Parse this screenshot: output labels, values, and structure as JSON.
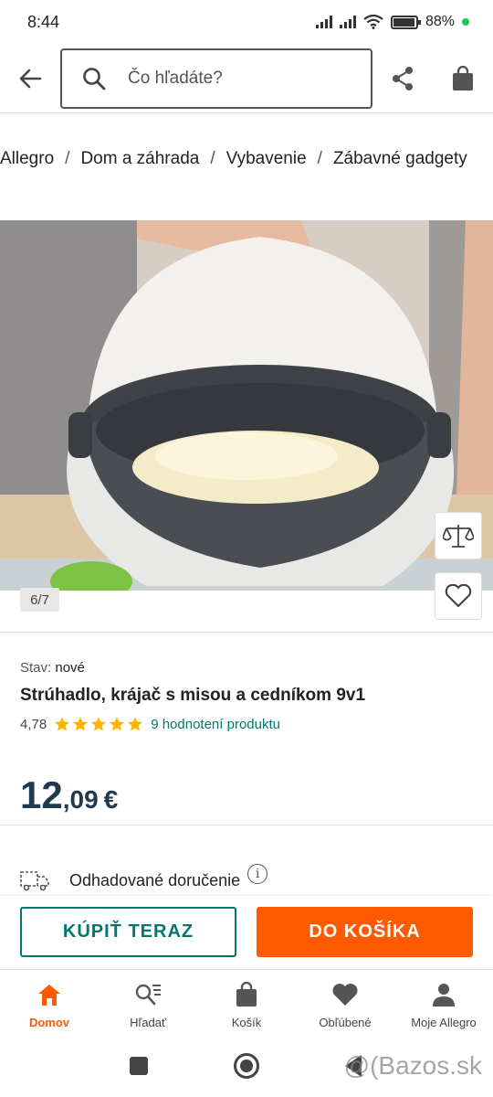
{
  "status": {
    "time": "8:44",
    "battery": "88%",
    "battery_level": 0.88
  },
  "header": {
    "search_placeholder": "Čo hľadáte?"
  },
  "breadcrumb": [
    "Allegro",
    "Dom a záhrada",
    "Vybavenie",
    "Zábavné gadgety"
  ],
  "gallery": {
    "counter": "6/7"
  },
  "product": {
    "condition_label": "Stav:",
    "condition_value": "nové",
    "title": "Strúhadlo, krájač s misou a cedníkom 9v1",
    "rating_value": "4,78",
    "stars": 5,
    "rating_link": "9 hodnotení produktu",
    "price_int": "12",
    "price_dec": ",09",
    "price_currency": "€"
  },
  "delivery": {
    "label": "Odhadované doručenie"
  },
  "actions": {
    "buy_now": "KÚPIŤ TERAZ",
    "add_to_cart": "DO KOŠÍKA"
  },
  "bottom_nav": [
    {
      "label": "Domov",
      "icon": "home-icon",
      "active": true
    },
    {
      "label": "Hľadať",
      "icon": "search-list-icon",
      "active": false
    },
    {
      "label": "Košík",
      "icon": "cart-icon",
      "active": false
    },
    {
      "label": "Obľúbené",
      "icon": "heart-icon",
      "active": false
    },
    {
      "label": "Moje Allegro",
      "icon": "person-icon",
      "active": false
    }
  ],
  "watermark": "@(Bazos.sk",
  "colors": {
    "accent": "#ff5a00",
    "teal": "#00786f",
    "price": "#1f3a4c",
    "star": "#ffb300"
  }
}
